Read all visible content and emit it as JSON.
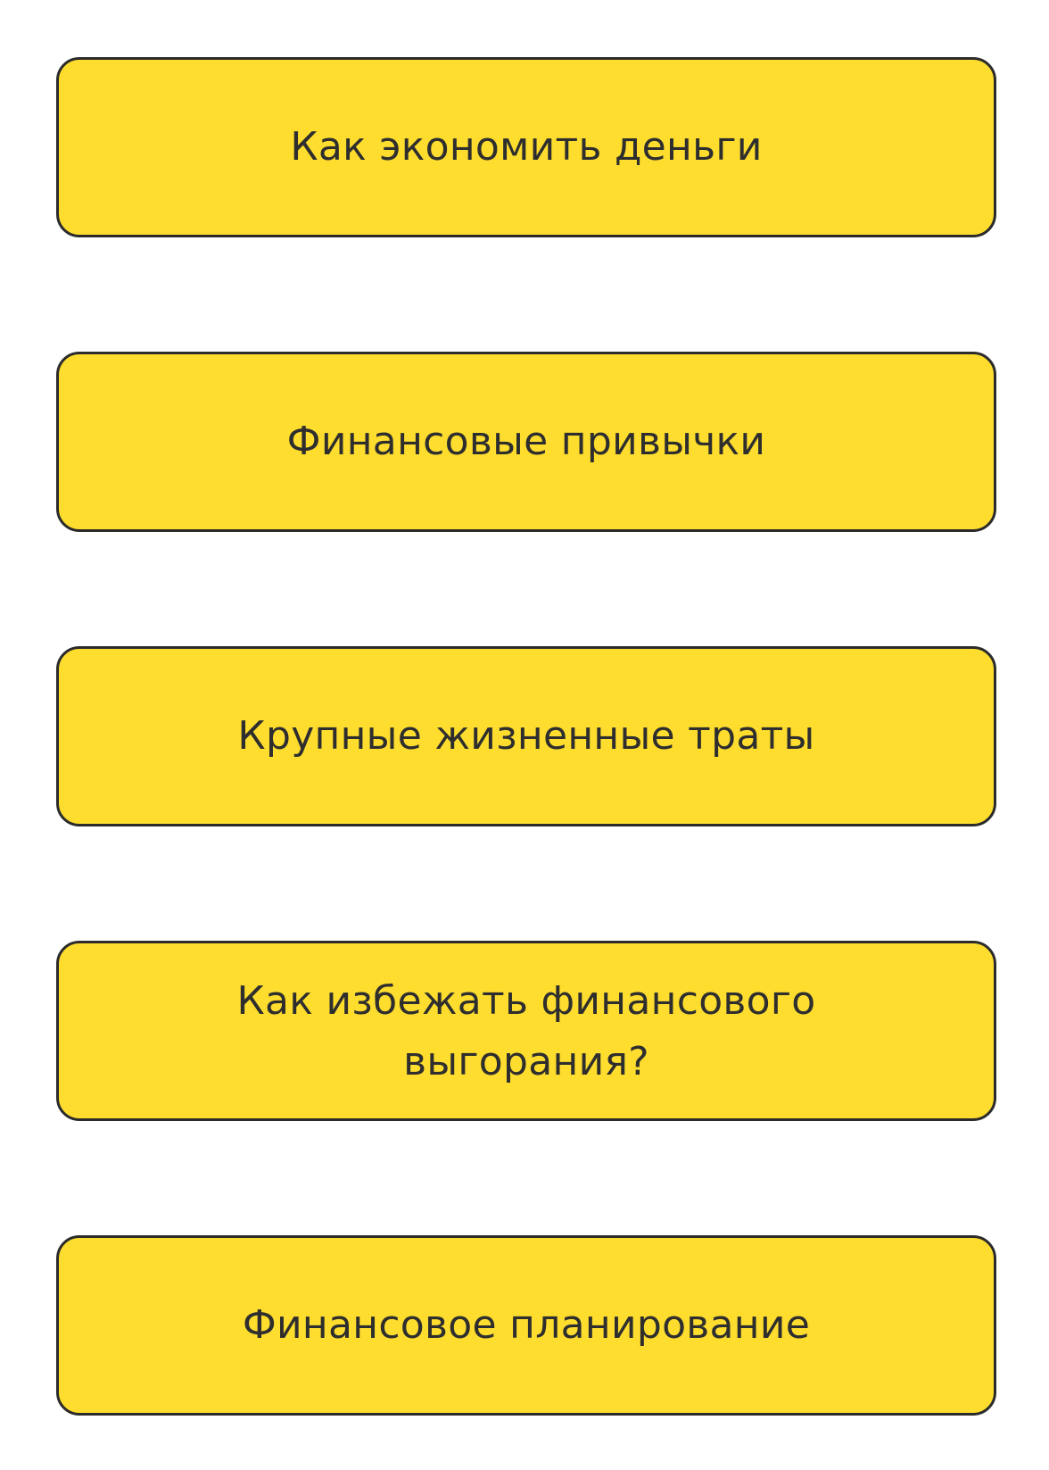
{
  "colors": {
    "card_fill": "#FEDD2E",
    "card_border": "#2b2b2b",
    "text": "#2e2e2e",
    "background": "#ffffff"
  },
  "topics": [
    {
      "label": "Как экономить деньги"
    },
    {
      "label": "Финансовые привычки"
    },
    {
      "label": "Крупные жизненные траты"
    },
    {
      "label_line1": "Как избежать финансового",
      "label_line2": "выгорания?"
    },
    {
      "label": "Финансовое планирование"
    }
  ]
}
